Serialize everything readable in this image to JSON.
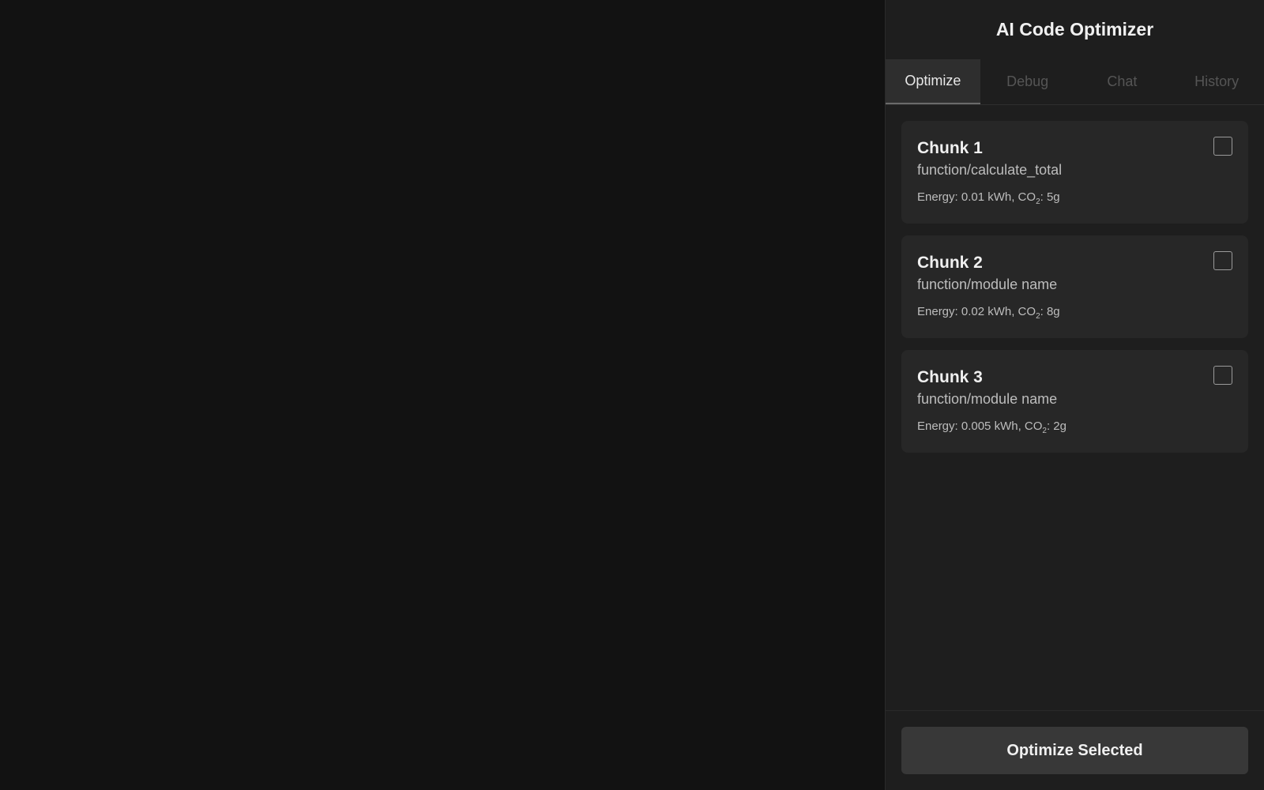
{
  "panel": {
    "title": "AI Code Optimizer"
  },
  "tabs": [
    {
      "label": "Optimize",
      "active": true
    },
    {
      "label": "Debug",
      "active": false
    },
    {
      "label": "Chat",
      "active": false
    },
    {
      "label": "History",
      "active": false
    }
  ],
  "chunks": [
    {
      "title": "Chunk 1",
      "subtitle": "function/calculate_total",
      "energy": "Energy: 0.01 kWh, CO",
      "co2": ": 5g",
      "checked": false
    },
    {
      "title": "Chunk 2",
      "subtitle": "function/module name",
      "energy": "Energy: 0.02 kWh, CO",
      "co2": ": 8g",
      "checked": false
    },
    {
      "title": "Chunk 3",
      "subtitle": "function/module name",
      "energy": "Energy: 0.005 kWh, CO",
      "co2": ": 2g",
      "checked": false
    }
  ],
  "footer": {
    "button_label": "Optimize Selected"
  },
  "colors": {
    "background": "#121212",
    "panel": "#1e1e1e",
    "card": "#272727",
    "active_tab": "#2e2e2e",
    "button": "#383838"
  }
}
